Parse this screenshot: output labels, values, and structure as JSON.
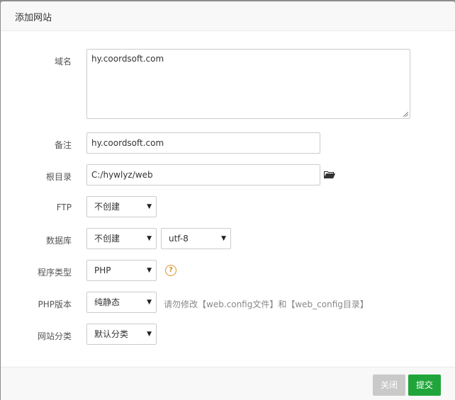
{
  "dialog": {
    "title": "添加网站"
  },
  "form": {
    "domain": {
      "label": "域名",
      "value": "hy.coordsoft.com"
    },
    "remark": {
      "label": "备注",
      "value": "hy.coordsoft.com"
    },
    "root_dir": {
      "label": "根目录",
      "value": "C:/hywlyz/web"
    },
    "ftp": {
      "label": "FTP",
      "value": "不创建"
    },
    "database": {
      "label": "数据库",
      "value": "不创建",
      "charset": "utf-8"
    },
    "program_type": {
      "label": "程序类型",
      "value": "PHP",
      "help_glyph": "?"
    },
    "php_version": {
      "label": "PHP版本",
      "value": "纯静态",
      "hint": "请勿修改【web.config文件】和【web_config目录】"
    },
    "site_category": {
      "label": "网站分类",
      "value": "默认分类"
    }
  },
  "footer": {
    "close_label": "关闭",
    "submit_label": "提交"
  },
  "icons": {
    "caret": "▼",
    "folder": "folder-open-icon",
    "help": "question-circle-icon"
  },
  "colors": {
    "submit": "#20a53a",
    "close": "#c9c9c9",
    "help": "#e0902a"
  }
}
